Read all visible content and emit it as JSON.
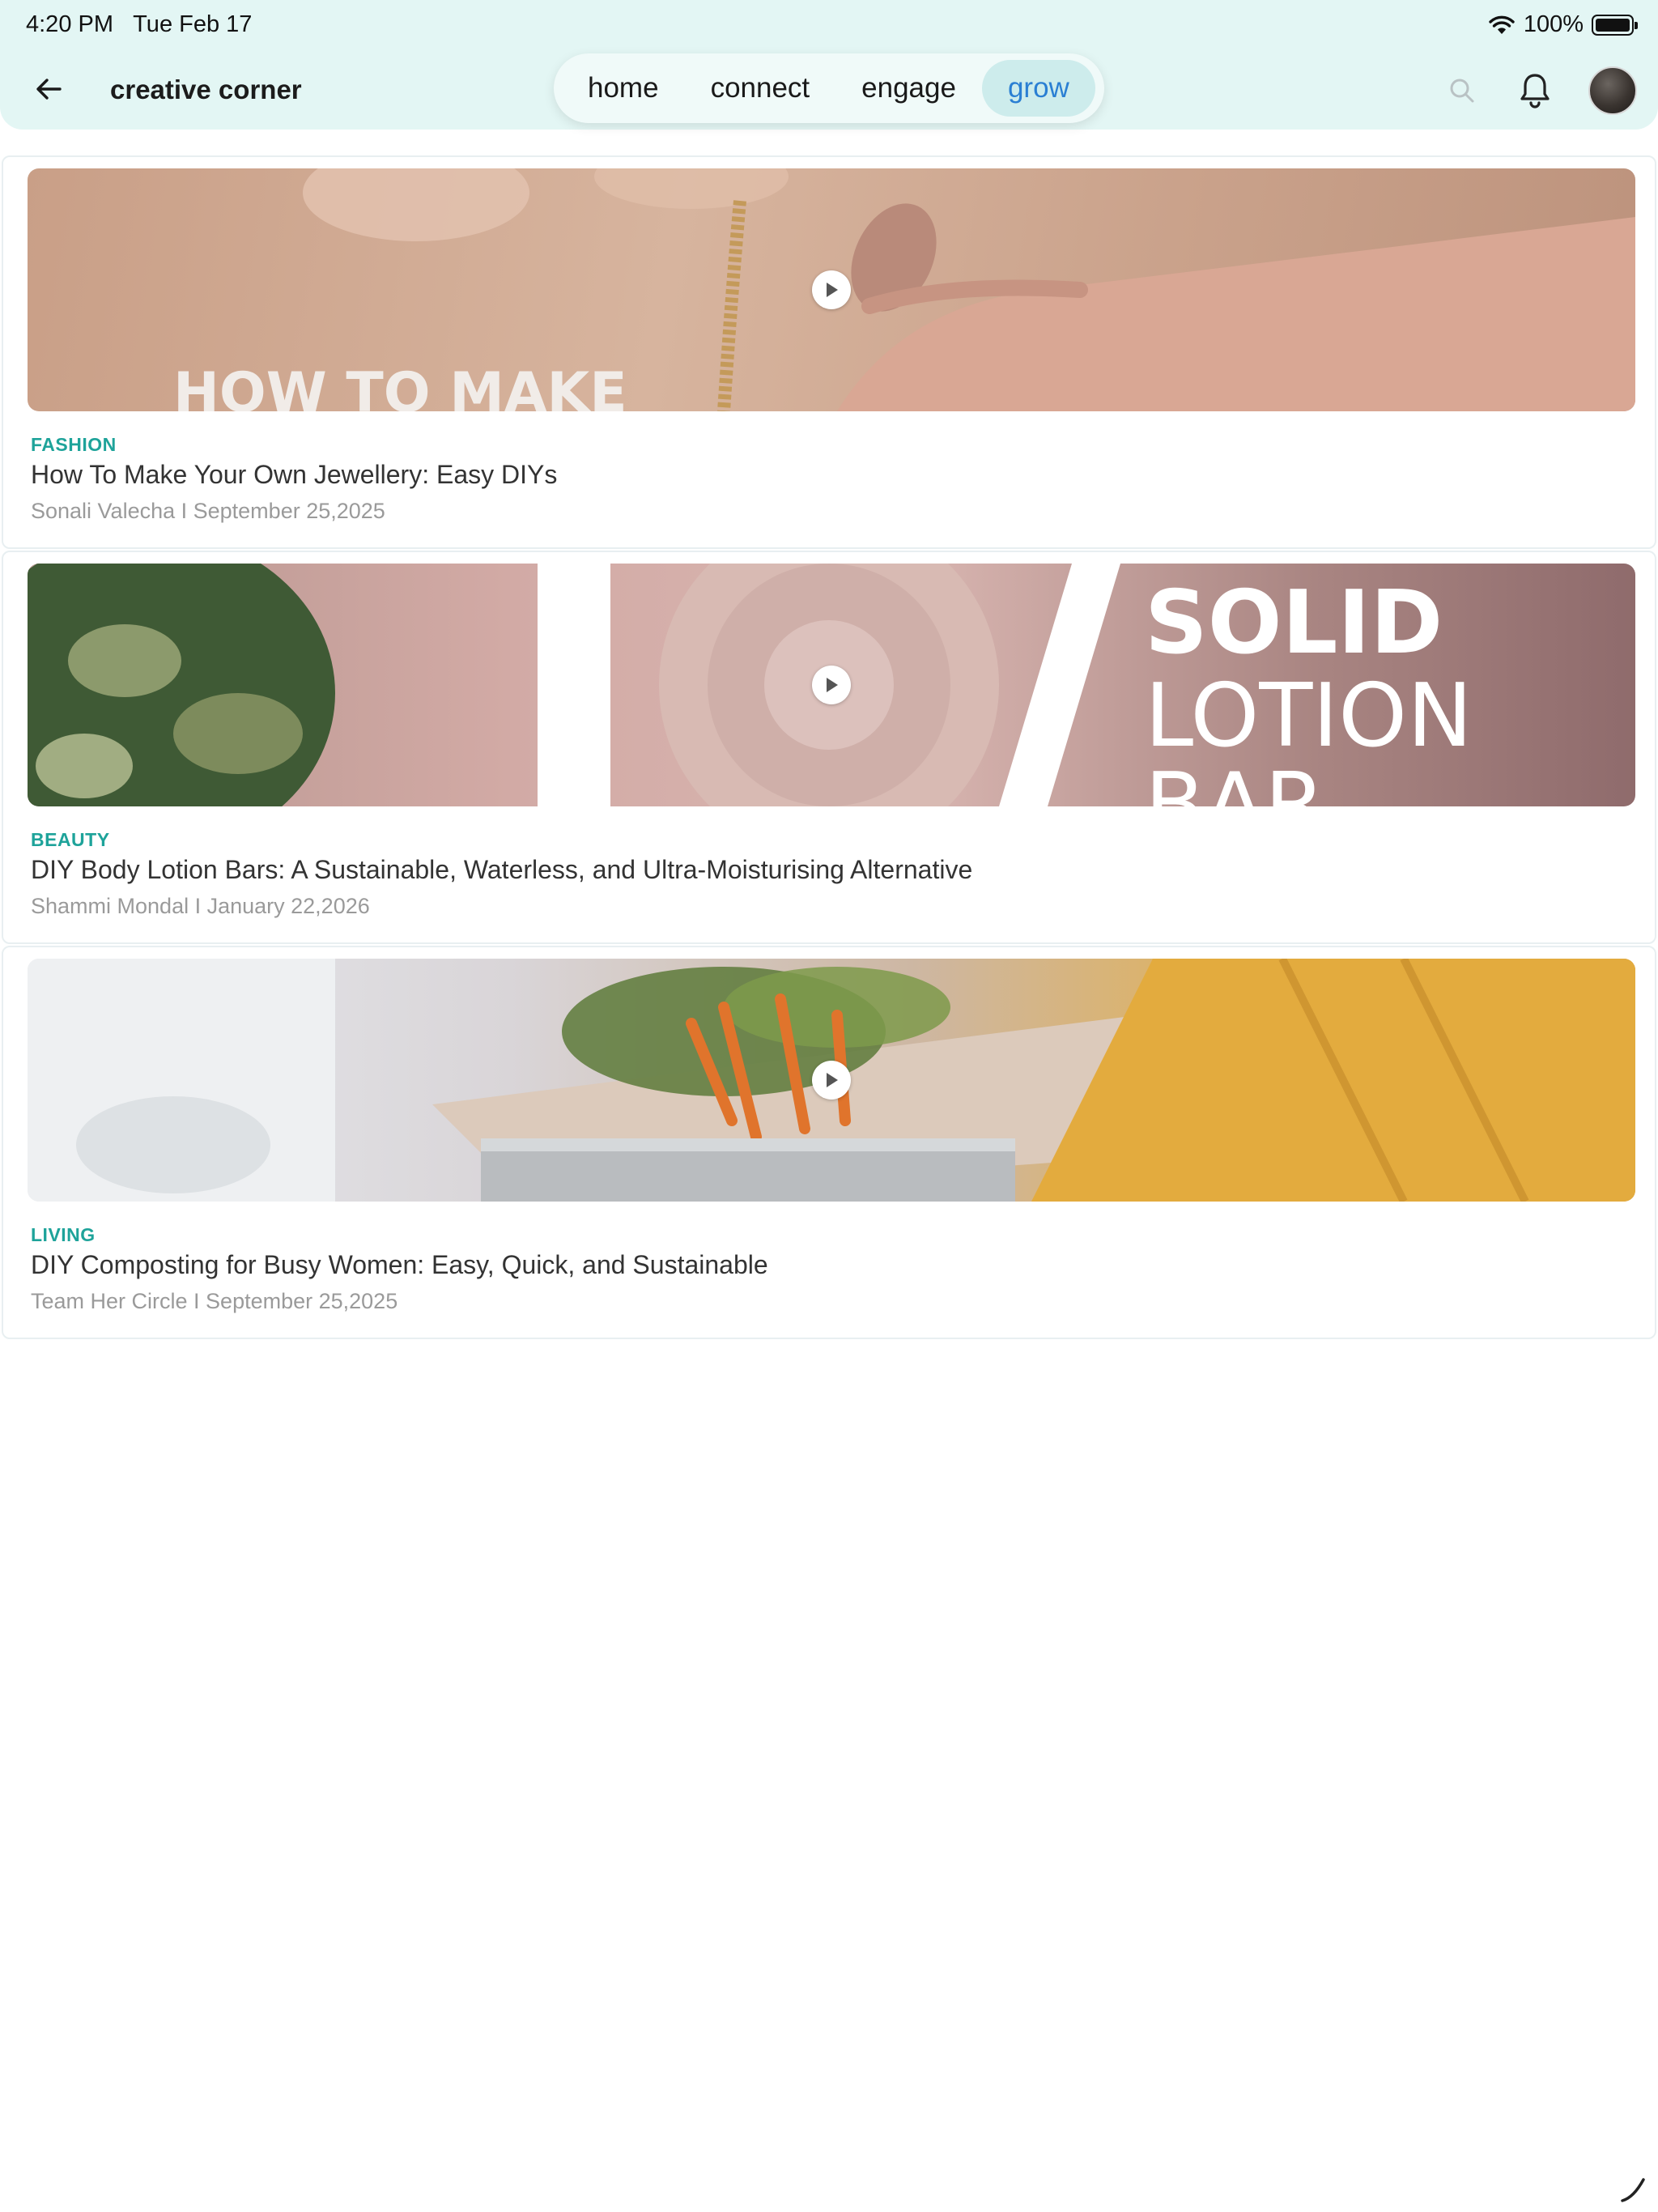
{
  "status_bar": {
    "time": "4:20 PM",
    "date": "Tue Feb 17",
    "battery": "100%"
  },
  "header": {
    "title": "creative corner",
    "tabs": [
      {
        "label": "home",
        "active": false
      },
      {
        "label": "connect",
        "active": false
      },
      {
        "label": "engage",
        "active": false
      },
      {
        "label": "grow",
        "active": true
      }
    ]
  },
  "colors": {
    "header_bg": "#e3f6f4",
    "accent": "#2a7fd3",
    "category": "#1ea39a"
  },
  "articles": [
    {
      "category": "FASHION",
      "title": "How To Make Your Own Jewellery: Easy DIYs",
      "meta": "Sonali Valecha I September 25,2025",
      "thumb_text": "HOW TO MAKE"
    },
    {
      "category": "BEAUTY",
      "title": "DIY Body Lotion Bars: A Sustainable, Waterless, and Ultra-Moisturising Alternative",
      "meta": "Shammi Mondal I January 22,2026",
      "thumb_text_1": "SOLID",
      "thumb_text_2": "LOTION",
      "thumb_text_3": "BAR"
    },
    {
      "category": "LIVING",
      "title": "DIY Composting for Busy Women: Easy, Quick, and Sustainable",
      "meta": "Team Her Circle I September 25,2025"
    }
  ]
}
